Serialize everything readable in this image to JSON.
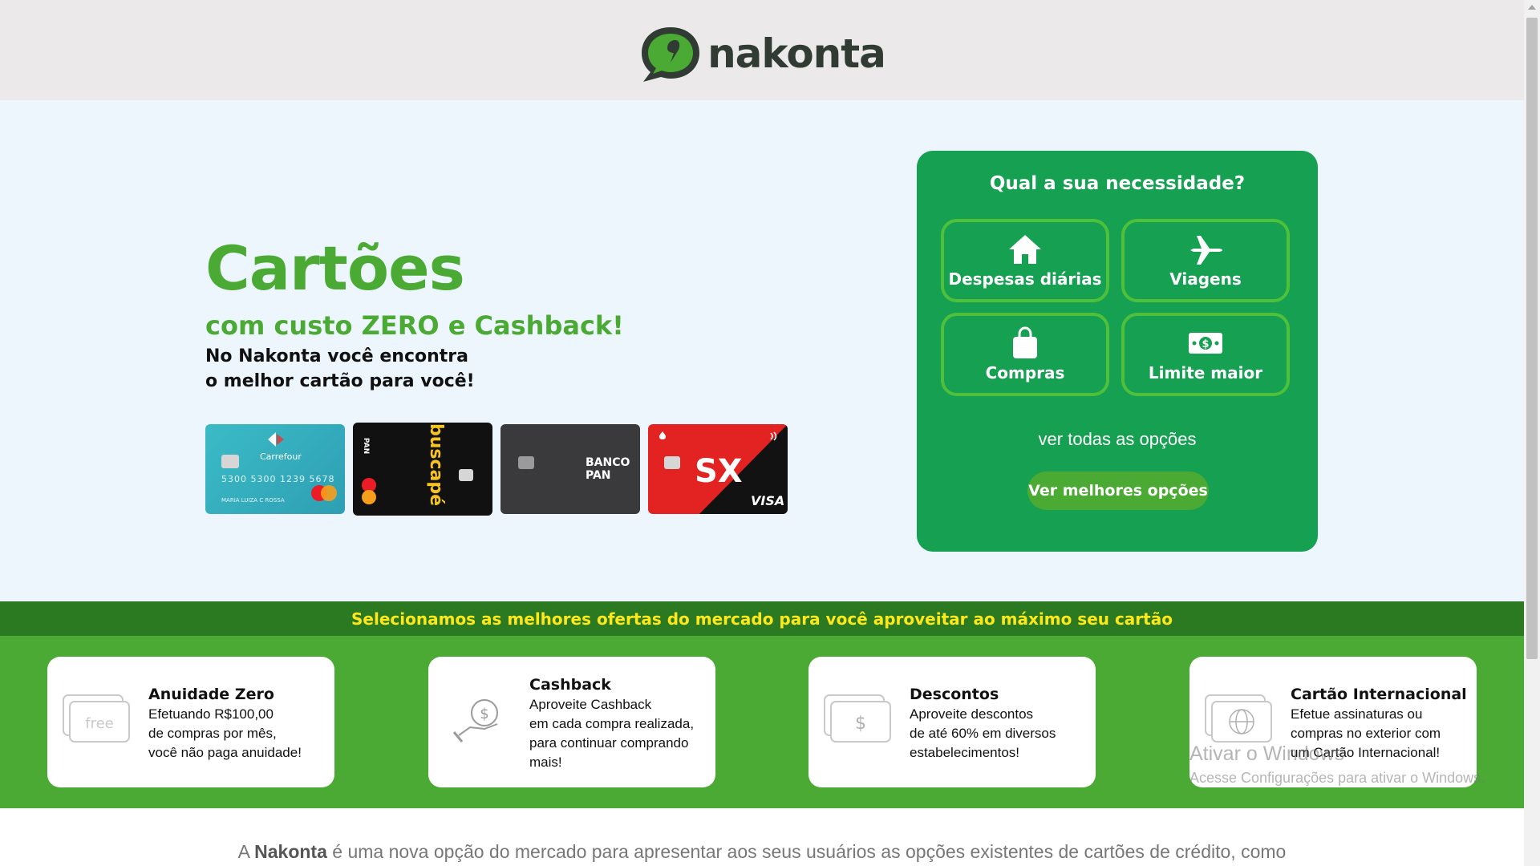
{
  "header": {
    "logo_text": "nakonta"
  },
  "hero": {
    "title": "Cartões",
    "subtitle": "com custo ZERO e Cashback!",
    "description_line1": "No Nakonta você encontra",
    "description_line2": "o melhor cartão para você!",
    "cards": [
      {
        "brand": "Carrefour",
        "number": "5300 5300 1239 5678",
        "holder": "MARIA LUIZA C ROSSA",
        "network": "mastercard"
      },
      {
        "brand": "buscapé",
        "issuer": "PAN"
      },
      {
        "brand": "BANCO PAN"
      },
      {
        "brand": "SX",
        "network": "VISA"
      }
    ]
  },
  "need_panel": {
    "title": "Qual a sua necessidade?",
    "options": [
      {
        "label": "Despesas diárias",
        "icon": "home-icon"
      },
      {
        "label": "Viagens",
        "icon": "plane-icon"
      },
      {
        "label": "Compras",
        "icon": "shopping-bag-icon"
      },
      {
        "label": "Limite maior",
        "icon": "money-icon"
      }
    ],
    "see_all": "ver todas as opções",
    "cta": "Ver melhores opções"
  },
  "banner": {
    "text": "Selecionamos as melhores ofertas do mercado para você aproveitar ao máximo seu cartão"
  },
  "features": [
    {
      "title": "Anuidade Zero",
      "text": "Efetuando R$100,00\nde compras por mês,\nvocê não paga anuidade!",
      "icon": "free-card-icon"
    },
    {
      "title": "Cashback",
      "text": "Aproveite Cashback\nem cada compra realizada,\npara continuar comprando\nmais!",
      "icon": "cashback-hand-icon"
    },
    {
      "title": "Descontos",
      "text": "Aproveite descontos\nde até 60% em diversos\nestabelecimentos!",
      "icon": "dollar-card-icon"
    },
    {
      "title": "Cartão Internacional",
      "text": "Efetue assinaturas ou\ncompras no exterior com\num Cartão Internacional!",
      "icon": "globe-card-icon"
    }
  ],
  "bottom": {
    "prefix": "A ",
    "brand": "Nakonta",
    "rest": " é uma nova opção do mercado para apresentar aos seus usuários as opções existentes de cartões de crédito, como"
  },
  "watermark": {
    "line1": "Ativar o Windows",
    "line2": "Acesse Configurações para ativar o Windows."
  },
  "colors": {
    "brand_green": "#4aaa33",
    "panel_green": "#16a052",
    "banner_green": "#2b7a22",
    "banner_text": "#ffe81a"
  }
}
